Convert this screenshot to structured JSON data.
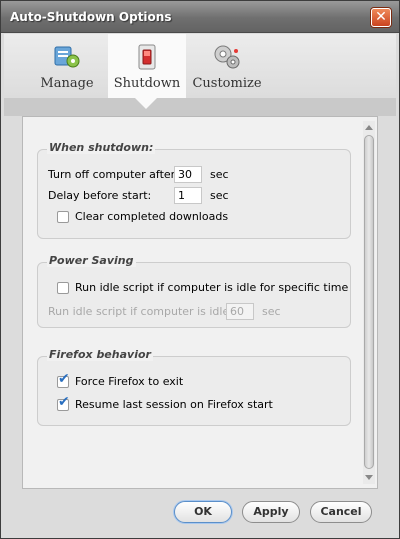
{
  "window": {
    "title": "Auto-Shutdown Options",
    "close_label": "✕"
  },
  "tabs": [
    {
      "label": "Manage",
      "icon": "manage-icon"
    },
    {
      "label": "Shutdown",
      "icon": "shutdown-icon",
      "selected": true
    },
    {
      "label": "Customize",
      "icon": "customize-icon"
    }
  ],
  "when_shutdown": {
    "title": "When shutdown:",
    "turn_off_label": "Turn off computer after:",
    "turn_off_value": "30",
    "turn_off_unit": "sec",
    "delay_label": "Delay before start:",
    "delay_value": "1",
    "delay_unit": "sec",
    "clear_downloads_label": "Clear completed downloads",
    "clear_downloads_checked": false
  },
  "power_saving": {
    "title": "Power Saving",
    "run_idle_label": "Run idle script if computer is idle for specific time",
    "run_idle_checked": false,
    "idle_field_label": "Run idle script if computer is idle for",
    "idle_value": "60",
    "idle_unit": "sec"
  },
  "firefox_behavior": {
    "title": "Firefox behavior",
    "force_exit_label": "Force Firefox to exit",
    "force_exit_checked": true,
    "resume_label": "Resume last session on Firefox start",
    "resume_checked": true
  },
  "buttons": {
    "ok": "OK",
    "apply": "Apply",
    "cancel": "Cancel"
  },
  "colors": {
    "accent": "#2a6fbf",
    "titlebar": "#6f6f6f",
    "close": "#c9431f"
  }
}
